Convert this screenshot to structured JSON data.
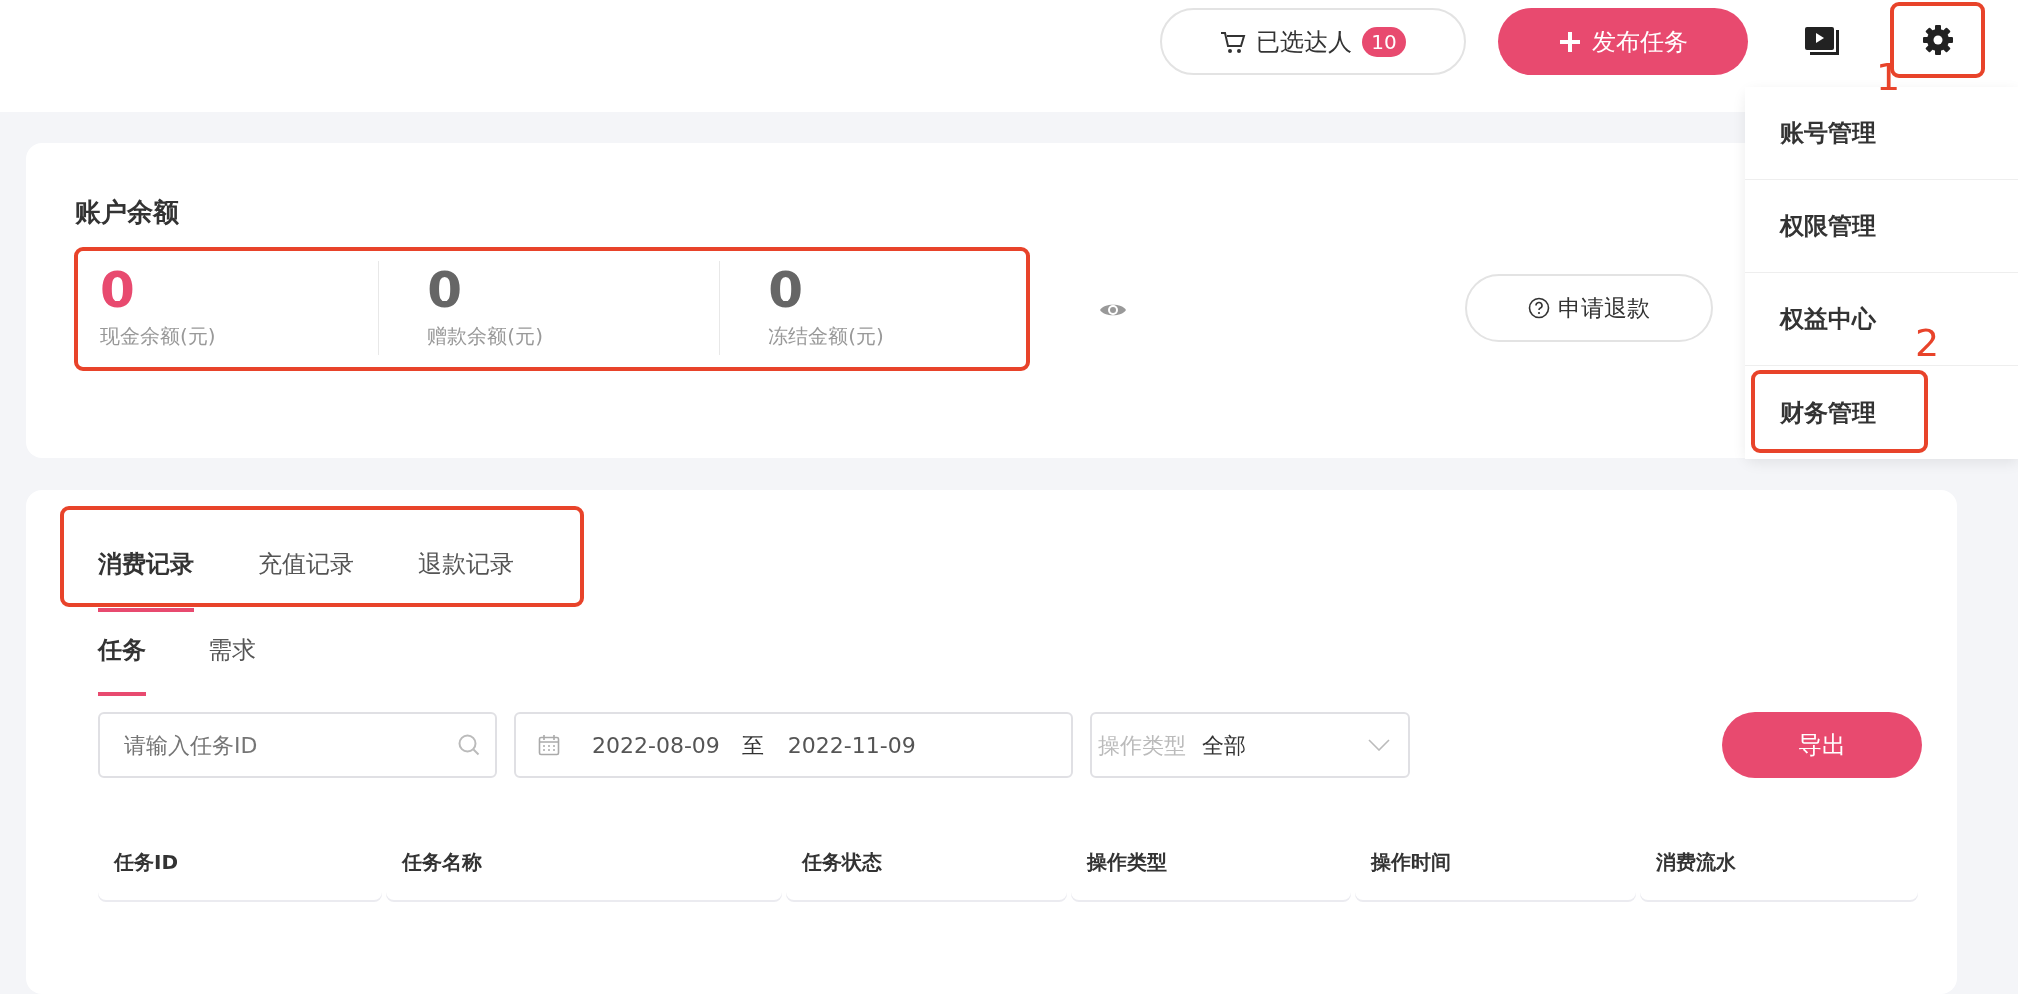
{
  "header": {
    "selected_button": {
      "label": "已选达人",
      "count": "10"
    },
    "publish_button": {
      "label": "发布任务"
    },
    "settings": {
      "annotated": true,
      "annotation_number": "1"
    }
  },
  "settings_menu": {
    "open": true,
    "items": [
      {
        "label": "账号管理",
        "annotated": false
      },
      {
        "label": "权限管理",
        "annotated": false
      },
      {
        "label": "权益中心",
        "annotated": false
      },
      {
        "label": "财务管理",
        "annotated": true,
        "annotation_number": "2"
      }
    ]
  },
  "balance": {
    "title": "账户余额",
    "annotated": true,
    "stats": [
      {
        "value": "0",
        "label": "现金余额(元)",
        "highlight": true
      },
      {
        "value": "0",
        "label": "赠款余额(元)",
        "highlight": false
      },
      {
        "value": "0",
        "label": "冻结金额(元)",
        "highlight": false
      }
    ],
    "refund_button": "申请退款"
  },
  "records": {
    "tabs_annotated": true,
    "tabs": [
      {
        "label": "消费记录",
        "selected": true
      },
      {
        "label": "充值记录",
        "selected": false
      },
      {
        "label": "退款记录",
        "selected": false
      }
    ],
    "subtabs": [
      {
        "label": "任务",
        "selected": true
      },
      {
        "label": "需求",
        "selected": false
      }
    ],
    "search": {
      "placeholder": "请输入任务ID"
    },
    "date_range": {
      "start": "2022-08-09",
      "separator": "至",
      "end": "2022-11-09"
    },
    "operation_filter": {
      "label": "操作类型",
      "value": "全部"
    },
    "export_button": "导出",
    "table": {
      "columns": [
        "任务ID",
        "任务名称",
        "任务状态",
        "操作类型",
        "操作时间",
        "消费流水"
      ]
    }
  }
}
